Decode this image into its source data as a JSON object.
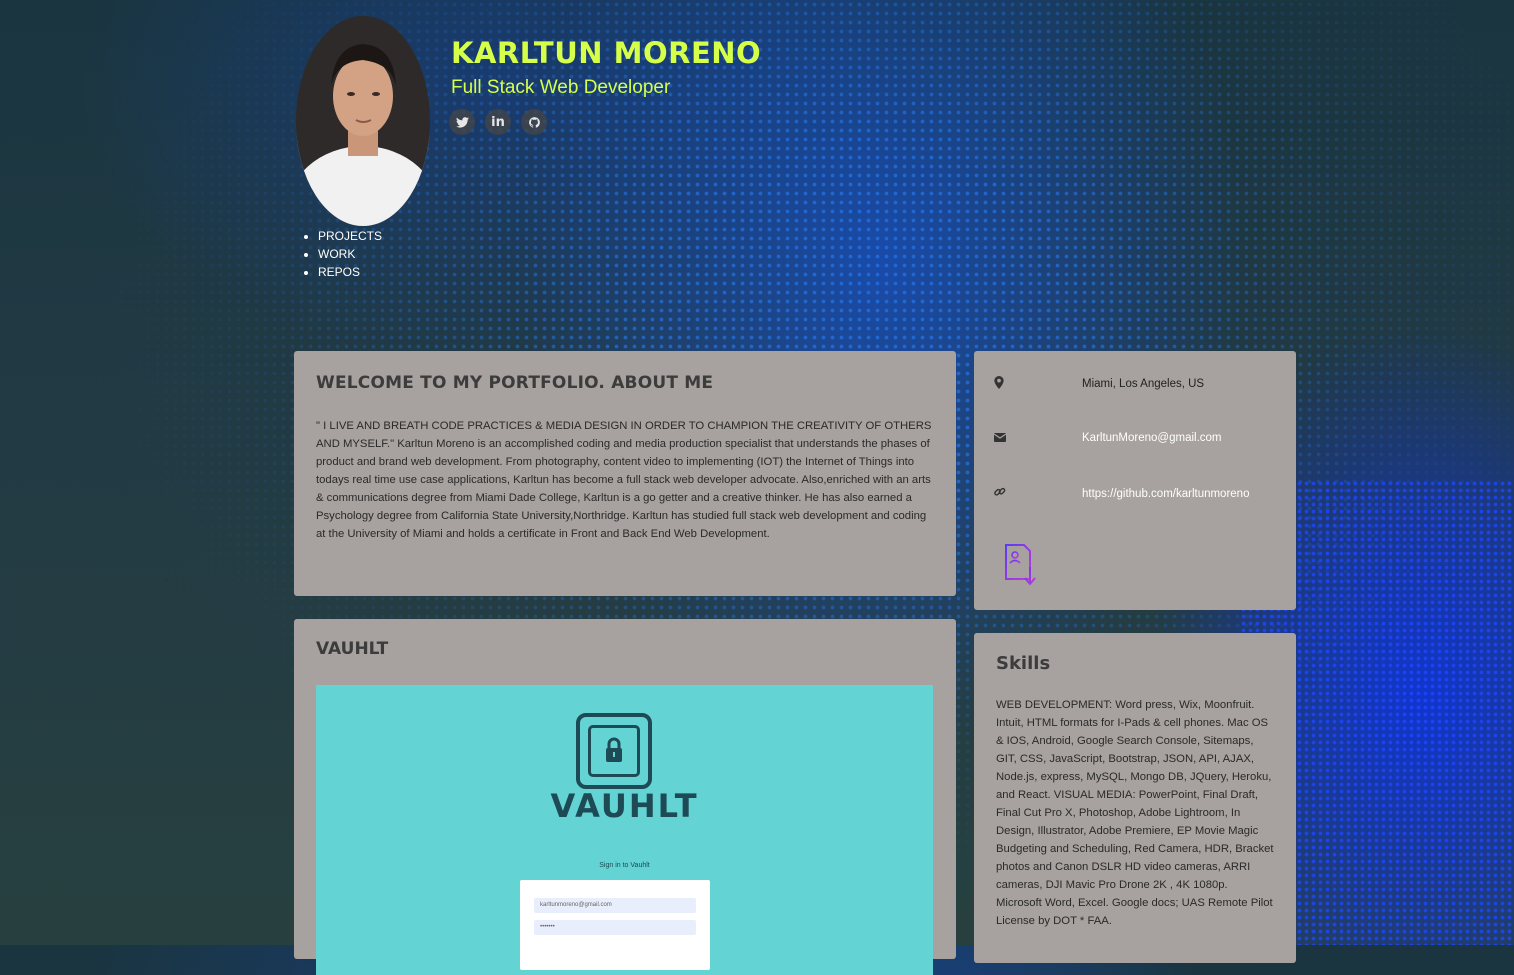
{
  "header": {
    "name": "KARLTUN MORENO",
    "role": "Full Stack Web Developer",
    "socials": [
      {
        "icon": "twitter-icon",
        "glyph": "🐦"
      },
      {
        "icon": "linkedin-icon",
        "glyph": "in"
      },
      {
        "icon": "github-icon",
        "glyph": "🐱"
      }
    ]
  },
  "nav": {
    "items": [
      "PROJECTS",
      "WORK",
      "REPOS"
    ]
  },
  "about": {
    "title": "WELCOME TO MY PORTFOLIO. ABOUT ME",
    "body": "\" I LIVE AND BREATH CODE PRACTICES & MEDIA DESIGN IN ORDER TO CHAMPION THE CREATIVITY OF OTHERS AND MYSELF.\" Karltun Moreno is an accomplished coding and media production specialist that understands the phases of product and brand web development. From photography, content video to implementing (IOT) the Internet of Things into todays real time use case applications, Karltun has become a full stack web developer advocate. Also,enriched with an arts & communications degree from Miami Dade College, Karltun is a go getter and a creative thinker. He has also earned a Psychology degree from California State University,Northridge. Karltun has studied full stack web development and coding at the University of Miami and holds a certificate in Front and Back End Web Development."
  },
  "contact": {
    "location": "Miami, Los Angeles, US",
    "email": "KarltunMoreno@gmail.com",
    "github": "https://github.com/karltunmoreno",
    "icons": [
      "map-marker-icon",
      "envelope-icon",
      "link-icon",
      "resume-download-icon"
    ]
  },
  "project": {
    "title": "VAUHLT",
    "screenshot": {
      "brand": "VAUHLT",
      "signin": "Sign in to Vauhlt",
      "email_value": "karltunmoreno@gmail.com",
      "password_value": "•••••••"
    }
  },
  "skills": {
    "title": "Skills",
    "body": "WEB DEVELOPMENT: Word press, Wix, Moonfruit. Intuit, HTML formats for I-Pads & cell phones. Mac OS & IOS, Android, Google Search Console, Sitemaps, GIT, CSS, JavaScript, Bootstrap, JSON, API, AJAX, Node.js, express, MySQL, Mongo DB, JQuery, Heroku, and React. VISUAL MEDIA: PowerPoint, Final Draft, Final Cut Pro X, Photoshop, Adobe Lightroom, In Design, Illustrator, Adobe Premiere, EP Movie Magic Budgeting and Scheduling, Red Camera, HDR, Bracket photos and Canon DSLR HD video cameras, ARRI cameras, DJI Mavic Pro Drone 2K , 4K 1080p. Microsoft Word, Excel. Google docs; UAS Remote Pilot License by DOT * FAA."
  },
  "colors": {
    "accent": "#d6ff47",
    "card": "#a7a19f",
    "project_bg": "#63d3d3"
  }
}
